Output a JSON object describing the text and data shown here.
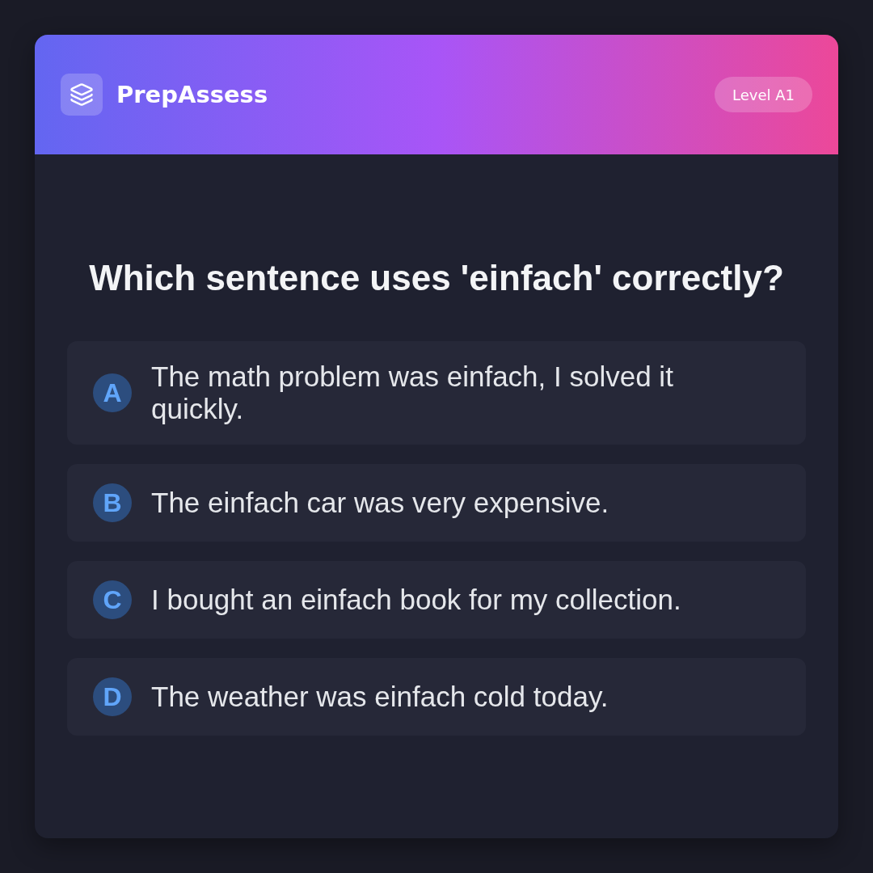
{
  "header": {
    "brand": "PrepAssess",
    "level_badge": "Level A1"
  },
  "question": "Which sentence uses 'einfach' correctly?",
  "options": [
    {
      "letter": "A",
      "text": "The math problem was einfach, I solved it quickly."
    },
    {
      "letter": "B",
      "text": "The einfach car was very expensive."
    },
    {
      "letter": "C",
      "text": "I bought an einfach book for my collection."
    },
    {
      "letter": "D",
      "text": "The weather was einfach cold today."
    }
  ]
}
